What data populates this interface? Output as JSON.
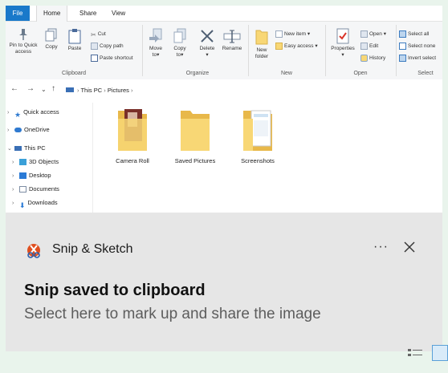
{
  "ribbon_tabs": [
    {
      "label": "File"
    },
    {
      "label": "Home"
    },
    {
      "label": "Share"
    },
    {
      "label": "View"
    }
  ],
  "ribbon": {
    "clipboard": {
      "pin": "Pin to Quick",
      "pin2": "access",
      "copy": "Copy",
      "paste": "Paste",
      "cut": "Cut",
      "copy_path": "Copy path",
      "paste_shortcut": "Paste shortcut",
      "group": "Clipboard"
    },
    "organize": {
      "move": "Move",
      "move2": "to",
      "copy": "Copy",
      "copy2": "to",
      "delete": "Delete",
      "rename": "Rename",
      "group": "Organize"
    },
    "new": {
      "new_folder": "New",
      "new_folder2": "folder",
      "new_item": "New item",
      "easy_access": "Easy access",
      "group": "New"
    },
    "open": {
      "properties": "Properties",
      "open": "Open",
      "edit": "Edit",
      "history": "History",
      "group": "Open"
    },
    "select": {
      "select_all": "Select all",
      "select_none": "Select none",
      "invert": "Invert select",
      "group": "Select"
    }
  },
  "address": {
    "crumbs": [
      "This PC",
      "Pictures"
    ]
  },
  "navpane": {
    "quick_access": "Quick access",
    "onedrive": "OneDrive",
    "this_pc": "This PC",
    "objects3d": "3D Objects",
    "desktop": "Desktop",
    "documents": "Documents",
    "downloads": "Downloads"
  },
  "folders": [
    {
      "label": "Camera Roll"
    },
    {
      "label": "Saved Pictures"
    },
    {
      "label": "Screenshots"
    }
  ],
  "toast": {
    "app_name": "Snip & Sketch",
    "more": "···",
    "title": "Snip saved to clipboard",
    "body": "Select here to mark up and share the image"
  },
  "colors": {
    "accent": "#1979ca",
    "folder": "#f8d775",
    "toast_bg": "#e6e6e6"
  }
}
